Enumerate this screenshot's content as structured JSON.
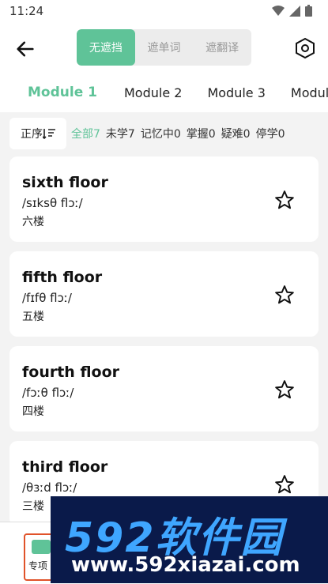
{
  "status": {
    "time": "11:24"
  },
  "header": {
    "segments": [
      "无遮挡",
      "遮单词",
      "遮翻译"
    ],
    "active_segment": 0
  },
  "tabs": [
    "Module 1",
    "Module 2",
    "Module 3",
    "Module"
  ],
  "filters": {
    "sort_label": "正序",
    "chips": [
      "全部7",
      "未学7",
      "记忆中0",
      "掌握0",
      "疑难0",
      "停学0"
    ]
  },
  "words": [
    {
      "word": "sixth floor",
      "ipa": "/sɪksθ flɔː/",
      "meaning": "六楼"
    },
    {
      "word": "fifth floor",
      "ipa": "/fɪfθ flɔː/",
      "meaning": "五楼"
    },
    {
      "word": "fourth floor",
      "ipa": "/fɔːθ flɔː/",
      "meaning": "四楼"
    },
    {
      "word": "third floor",
      "ipa": "/θɜːd flɔː/",
      "meaning": "三楼"
    }
  ],
  "bottom": {
    "special_label": "专项"
  },
  "watermark": {
    "line1": "592软件园",
    "line2": "www.592xiazai.com"
  },
  "colors": {
    "accent": "#5fc398",
    "highlight_border": "#e0532a"
  }
}
